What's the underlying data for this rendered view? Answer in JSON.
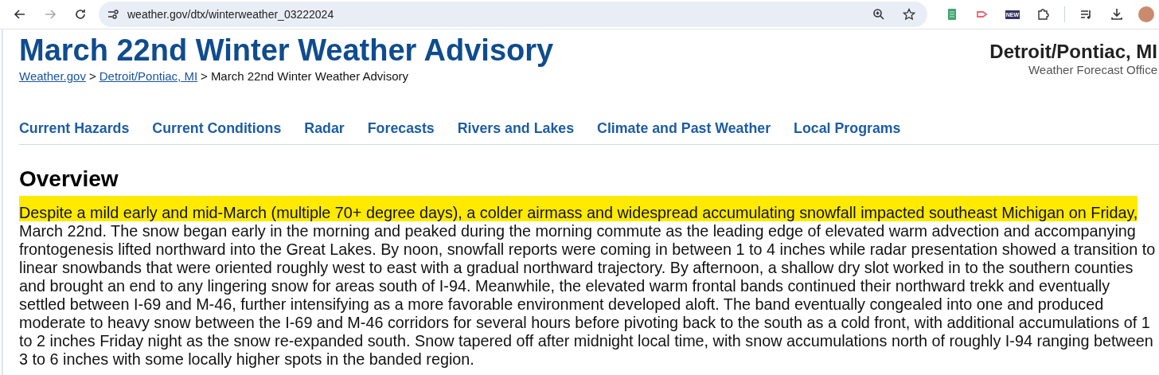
{
  "browser": {
    "url": "weather.gov/dtx/winterweather_03222024",
    "extension_badge": "NEW"
  },
  "header": {
    "title": "March 22nd Winter Weather Advisory",
    "breadcrumbs": [
      {
        "label": "Weather.gov",
        "kind": "link"
      },
      {
        "label": "Detroit/Pontiac, MI",
        "kind": "link"
      },
      {
        "label": "March 22nd Winter Weather Advisory",
        "kind": "current"
      }
    ],
    "separator": ">",
    "office": {
      "name": "Detroit/Pontiac, MI",
      "subtitle": "Weather Forecast Office"
    }
  },
  "nav": [
    "Current Hazards",
    "Current Conditions",
    "Radar",
    "Forecasts",
    "Rivers and Lakes",
    "Climate and Past Weather",
    "Local Programs"
  ],
  "overview": {
    "heading": "Overview",
    "highlighted": "Despite a mild early and mid-March (multiple 70+ degree days), a colder airmass and widespread accumulating snowfall impacted southeast Michigan on Friday,",
    "text": "March 22nd. The snow began early in the morning and peaked during the morning commute as the leading edge of elevated warm advection and accompanying frontogenesis lifted northward into the Great Lakes. By noon, snowfall reports were coming in between 1 to 4 inches while radar presentation showed a transition to linear snowbands that were oriented roughly west to east with a gradual northward trajectory. By afternoon, a shallow dry slot worked in to the southern counties and brought an end to any lingering snow for areas south of I-94. Meanwhile, the elevated warm frontal bands continued their northward trekk and eventually settled between I-69 and M-46, further intensifying as a more favorable environment developed aloft. The band eventually congealed into one and produced moderate to heavy snow between the I-69 and M-46 corridors for several hours before pivoting back to the south as a cold front, with additional accumulations of 1 to 2 inches Friday night as the snow re-expanded south. Snow tapered off after midnight local time, with snow accumulations north of roughly I-94 ranging between 3 to 6 inches with some locally higher spots in the banded region."
  }
}
